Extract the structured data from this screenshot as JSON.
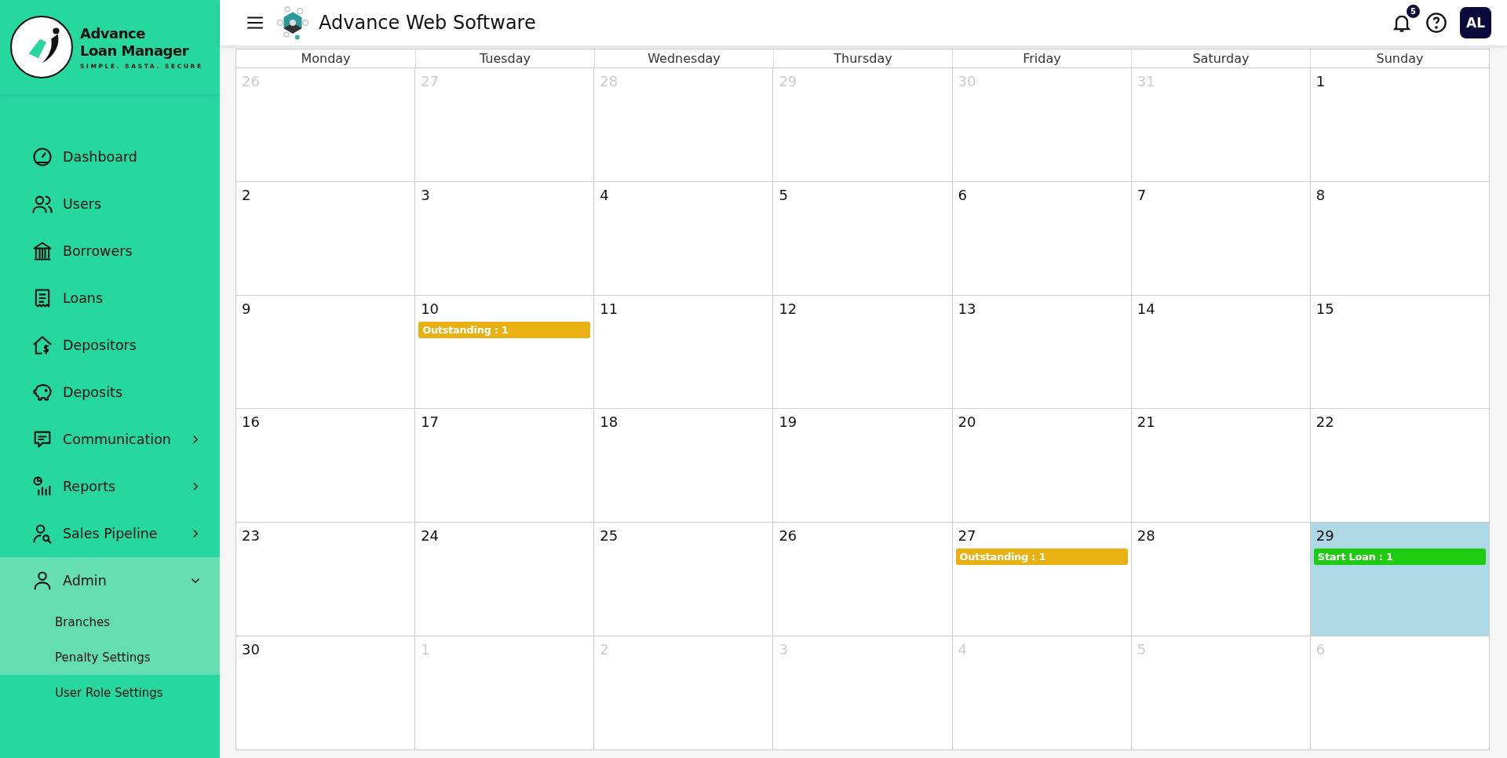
{
  "sidebar": {
    "logo": {
      "line_1": "Advance",
      "line_2": "Loan Manager",
      "tagline": "SIMPLE. SASTA. SECURE"
    },
    "items": [
      {
        "label": "Dashboard"
      },
      {
        "label": "Users"
      },
      {
        "label": "Borrowers"
      },
      {
        "label": "Loans"
      },
      {
        "label": "Depositors"
      },
      {
        "label": "Deposits"
      },
      {
        "label": "Communication",
        "expanded": false
      },
      {
        "label": "Reports",
        "expanded": false
      },
      {
        "label": "Sales Pipeline",
        "expanded": false
      },
      {
        "label": "Admin",
        "expanded": true,
        "highlighted": true,
        "children": [
          {
            "label": "Branches",
            "highlighted": true
          },
          {
            "label": "Penalty Settings",
            "highlighted": true
          },
          {
            "label": "User Role Settings",
            "highlighted": false
          }
        ]
      }
    ]
  },
  "header": {
    "title": "Advance Web Software",
    "notification_count": "5",
    "avatar": "AL"
  },
  "calendar": {
    "weekdays": [
      "Monday",
      "Tuesday",
      "Wednesday",
      "Thursday",
      "Friday",
      "Saturday",
      "Sunday"
    ],
    "days": [
      {
        "day": "26",
        "in_month": false,
        "selected": false
      },
      {
        "day": "27",
        "in_month": false,
        "selected": false
      },
      {
        "day": "28",
        "in_month": false,
        "selected": false
      },
      {
        "day": "29",
        "in_month": false,
        "selected": false
      },
      {
        "day": "30",
        "in_month": false,
        "selected": false
      },
      {
        "day": "31",
        "in_month": false,
        "selected": false
      },
      {
        "day": "1",
        "in_month": true,
        "selected": false
      },
      {
        "day": "2",
        "in_month": true,
        "selected": false
      },
      {
        "day": "3",
        "in_month": true,
        "selected": false
      },
      {
        "day": "4",
        "in_month": true,
        "selected": false
      },
      {
        "day": "5",
        "in_month": true,
        "selected": false
      },
      {
        "day": "6",
        "in_month": true,
        "selected": false
      },
      {
        "day": "7",
        "in_month": true,
        "selected": false
      },
      {
        "day": "8",
        "in_month": true,
        "selected": false
      },
      {
        "day": "9",
        "in_month": true,
        "selected": false
      },
      {
        "day": "10",
        "in_month": true,
        "selected": false,
        "events": [
          {
            "label": "Outstanding : 1",
            "color": "#e8b010"
          }
        ]
      },
      {
        "day": "11",
        "in_month": true,
        "selected": false
      },
      {
        "day": "12",
        "in_month": true,
        "selected": false
      },
      {
        "day": "13",
        "in_month": true,
        "selected": false
      },
      {
        "day": "14",
        "in_month": true,
        "selected": false
      },
      {
        "day": "15",
        "in_month": true,
        "selected": false
      },
      {
        "day": "16",
        "in_month": true,
        "selected": false
      },
      {
        "day": "17",
        "in_month": true,
        "selected": false
      },
      {
        "day": "18",
        "in_month": true,
        "selected": false
      },
      {
        "day": "19",
        "in_month": true,
        "selected": false
      },
      {
        "day": "20",
        "in_month": true,
        "selected": false
      },
      {
        "day": "21",
        "in_month": true,
        "selected": false
      },
      {
        "day": "22",
        "in_month": true,
        "selected": false
      },
      {
        "day": "23",
        "in_month": true,
        "selected": false
      },
      {
        "day": "24",
        "in_month": true,
        "selected": false
      },
      {
        "day": "25",
        "in_month": true,
        "selected": false
      },
      {
        "day": "26",
        "in_month": true,
        "selected": false
      },
      {
        "day": "27",
        "in_month": true,
        "selected": false,
        "events": [
          {
            "label": "Outstanding : 1",
            "color": "#e8b010"
          }
        ]
      },
      {
        "day": "28",
        "in_month": true,
        "selected": false
      },
      {
        "day": "29",
        "in_month": true,
        "selected": true,
        "events": [
          {
            "label": "Start Loan : 1",
            "color": "#1ecb10"
          }
        ]
      },
      {
        "day": "30",
        "in_month": true,
        "selected": false
      },
      {
        "day": "1",
        "in_month": false,
        "selected": false
      },
      {
        "day": "2",
        "in_month": false,
        "selected": false
      },
      {
        "day": "3",
        "in_month": false,
        "selected": false
      },
      {
        "day": "4",
        "in_month": false,
        "selected": false
      },
      {
        "day": "5",
        "in_month": false,
        "selected": false
      },
      {
        "day": "6",
        "in_month": false,
        "selected": false
      }
    ]
  }
}
